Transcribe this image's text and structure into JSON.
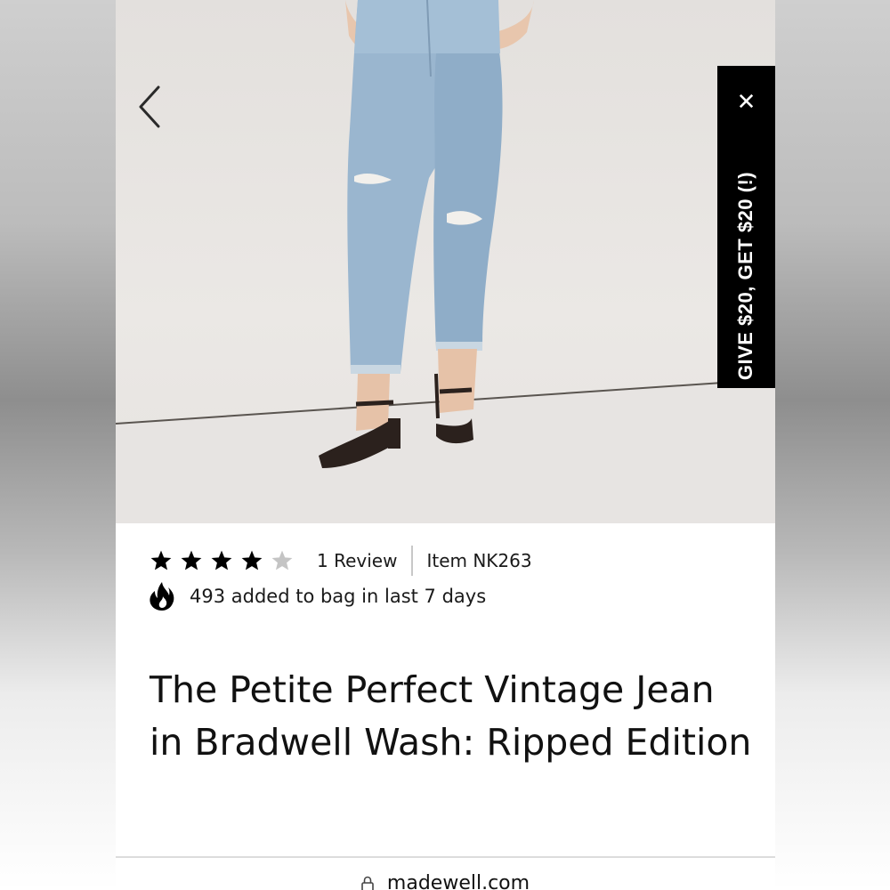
{
  "promo": {
    "label": "GIVE $20, GET $20 (!)",
    "close_glyph": "✕"
  },
  "gallery": {
    "prev_icon": "chevron-left-icon"
  },
  "rating": {
    "stars_filled": 4,
    "stars_total": 5,
    "review_count": "1 Review",
    "item_number": "Item NK263"
  },
  "popularity": {
    "icon": "flame-icon",
    "text": "493 added to bag in last 7 days"
  },
  "product": {
    "title": "The Petite Perfect Vintage Jean in Bradwell Wash: Ripped Edition"
  },
  "browser": {
    "url": "madewell.com"
  },
  "colors": {
    "promo_bg": "#000000",
    "text": "#111111",
    "star_filled": "#000000",
    "star_empty": "#c4c4c4"
  }
}
